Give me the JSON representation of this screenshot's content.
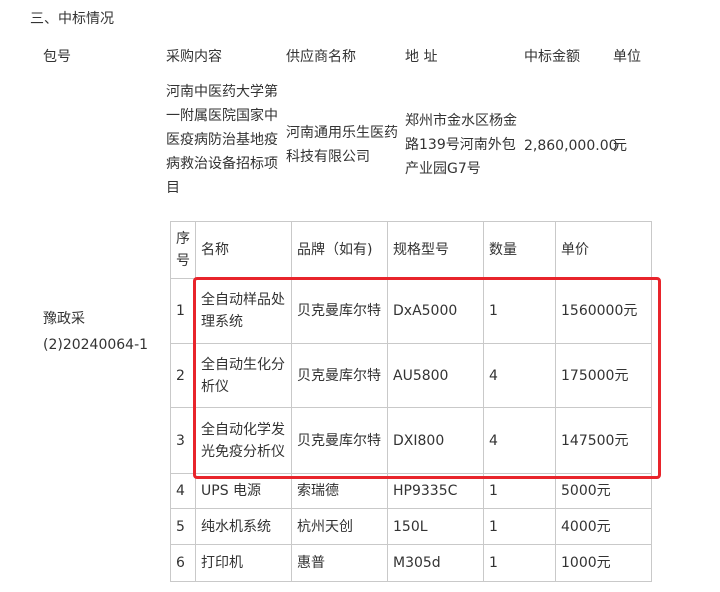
{
  "section_title": "三、中标情况",
  "headers": {
    "package": "包号",
    "content": "采购内容",
    "supplier": "供应商名称",
    "address": "地 址",
    "amount": "中标金额",
    "unit": "单位"
  },
  "award": {
    "package_no": "豫政采\n(2)20240064-1",
    "content": "河南中医药大学第\n一附属医院国家中\n医疫病防治基地疫\n病救治设备招标项\n目",
    "supplier": "河南通用乐生医药\n科技有限公司",
    "address": "郑州市金水区杨金\n路139号河南外包\n产业园G7号",
    "amount": "2,860,000.00",
    "unit": "元"
  },
  "items_table": {
    "headers": [
      "序\n号",
      "名称",
      "品牌（如有)",
      "规格型号",
      "数量",
      "单价"
    ],
    "rows": [
      [
        "1",
        "全自动样品处\n理系统",
        "贝克曼库尔特",
        "DxA5000",
        "1",
        "1560000元"
      ],
      [
        "2",
        "全自动生化分\n析仪",
        "贝克曼库尔特",
        "AU5800",
        "4",
        "175000元"
      ],
      [
        "3",
        "全自动化学发\n光免疫分析仪",
        "贝克曼库尔特",
        "DXI800",
        "4",
        "147500元"
      ],
      [
        "4",
        "UPS 电源",
        "索瑞德",
        "HP9335C",
        "1",
        "5000元"
      ],
      [
        "5",
        "纯水机系统",
        "杭州天创",
        "150L",
        "1",
        "4000元"
      ],
      [
        "6",
        "打印机",
        "惠普",
        "M305d",
        "1",
        "1000元"
      ]
    ]
  },
  "highlight_color": "#e8242b"
}
